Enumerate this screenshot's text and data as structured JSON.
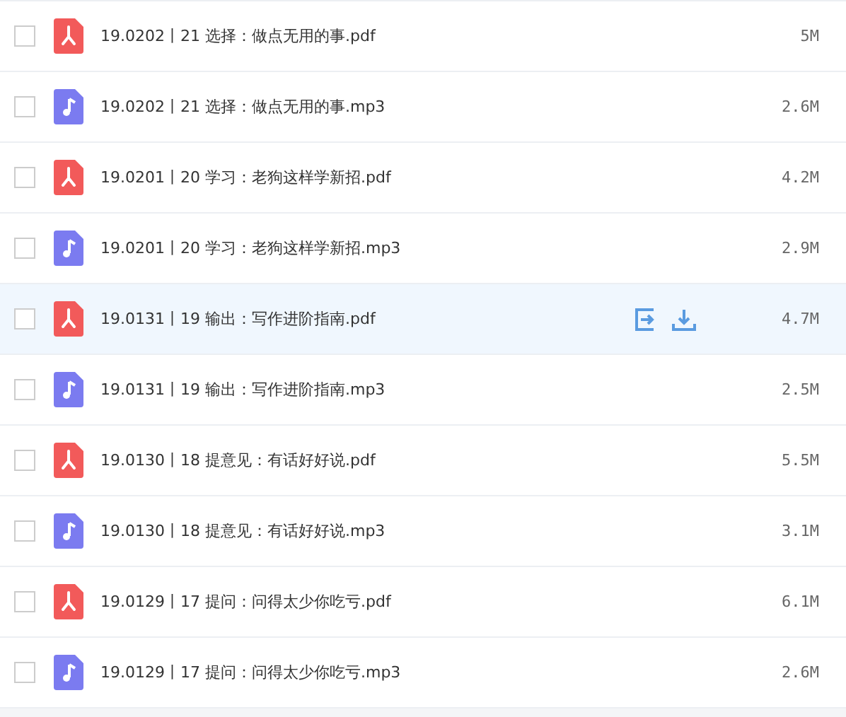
{
  "files": [
    {
      "name": "19.0202丨21 选择：做点无用的事.pdf",
      "kind": "pdf",
      "size": "5M",
      "checked": false,
      "hovered": false
    },
    {
      "name": "19.0202丨21 选择：做点无用的事.mp3",
      "kind": "mp3",
      "size": "2.6M",
      "checked": false,
      "hovered": false
    },
    {
      "name": "19.0201丨20 学习：老狗这样学新招.pdf",
      "kind": "pdf",
      "size": "4.2M",
      "checked": false,
      "hovered": false
    },
    {
      "name": "19.0201丨20 学习：老狗这样学新招.mp3",
      "kind": "mp3",
      "size": "2.9M",
      "checked": false,
      "hovered": false
    },
    {
      "name": "19.0131丨19 输出：写作进阶指南.pdf",
      "kind": "pdf",
      "size": "4.7M",
      "checked": false,
      "hovered": true
    },
    {
      "name": "19.0131丨19 输出：写作进阶指南.mp3",
      "kind": "mp3",
      "size": "2.5M",
      "checked": false,
      "hovered": false
    },
    {
      "name": "19.0130丨18 提意见：有话好好说.pdf",
      "kind": "pdf",
      "size": "5.5M",
      "checked": false,
      "hovered": false
    },
    {
      "name": "19.0130丨18 提意见：有话好好说.mp3",
      "kind": "mp3",
      "size": "3.1M",
      "checked": false,
      "hovered": false
    },
    {
      "name": "19.0129丨17 提问：问得太少你吃亏.pdf",
      "kind": "pdf",
      "size": "6.1M",
      "checked": false,
      "hovered": false
    },
    {
      "name": "19.0129丨17 提问：问得太少你吃亏.mp3",
      "kind": "mp3",
      "size": "2.6M",
      "checked": false,
      "hovered": false
    }
  ]
}
